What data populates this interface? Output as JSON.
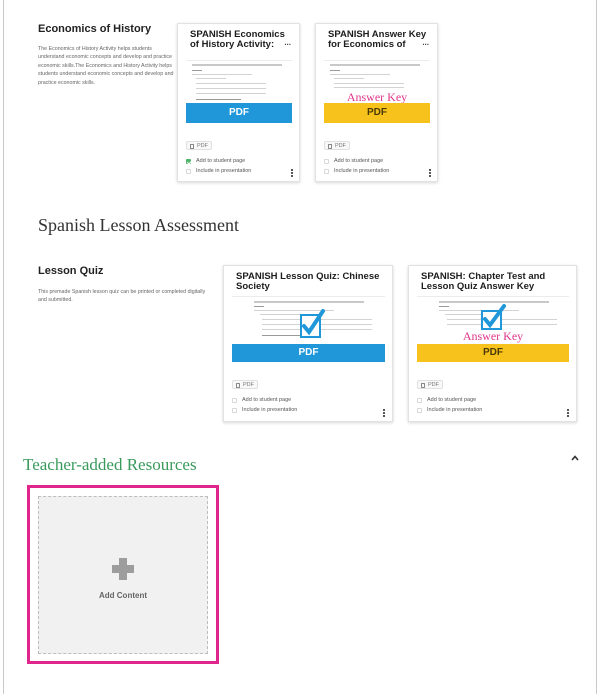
{
  "sections": {
    "economics": {
      "title": "Economics of History",
      "description": "The Economics of History Activity helps students understand economic concepts and develop and practice economic skills.The Economics and History Activity helps students understand economic concepts and develop and practice economic skills.",
      "cards": [
        {
          "title": "SPANISH Economics of History Activity:",
          "title_ellipsis": "...",
          "band_label": "PDF",
          "band_color": "#1f97d9",
          "file_tag": "PDF",
          "add_to_student_page": "Add to student page",
          "add_checked": true,
          "include_in_presentation": "Include in presentation"
        },
        {
          "title": "SPANISH Answer Key for Economics of",
          "title_ellipsis": "...",
          "answer_key_text": "Answer Key",
          "band_label": "PDF",
          "band_color": "#f7c21b",
          "file_tag": "PDF",
          "add_to_student_page": "Add to student page",
          "add_checked": false,
          "include_in_presentation": "Include in presentation"
        }
      ]
    },
    "assessment": {
      "heading": "Spanish Lesson Assessment",
      "title": "Lesson Quiz",
      "description": "This premade Spanish lesson quiz can be printed or completed digitally and submitted.",
      "cards": [
        {
          "title": "SPANISH Lesson Quiz: Chinese Society",
          "band_label": "PDF",
          "band_color": "#1f97d9",
          "file_tag": "PDF",
          "add_to_student_page": "Add to student page",
          "include_in_presentation": "Include in presentation"
        },
        {
          "title": "SPANISH: Chapter Test and Lesson Quiz Answer Key",
          "answer_key_text": "Answer Key",
          "band_label": "PDF",
          "band_color": "#f7c21b",
          "file_tag": "PDF",
          "add_to_student_page": "Add to student page",
          "include_in_presentation": "Include in presentation"
        }
      ]
    },
    "teacher": {
      "heading": "Teacher-added Resources",
      "collapse_icon": "chevron-up-icon",
      "add_content_label": "Add Content",
      "highlight_color": "#e0268b"
    }
  }
}
